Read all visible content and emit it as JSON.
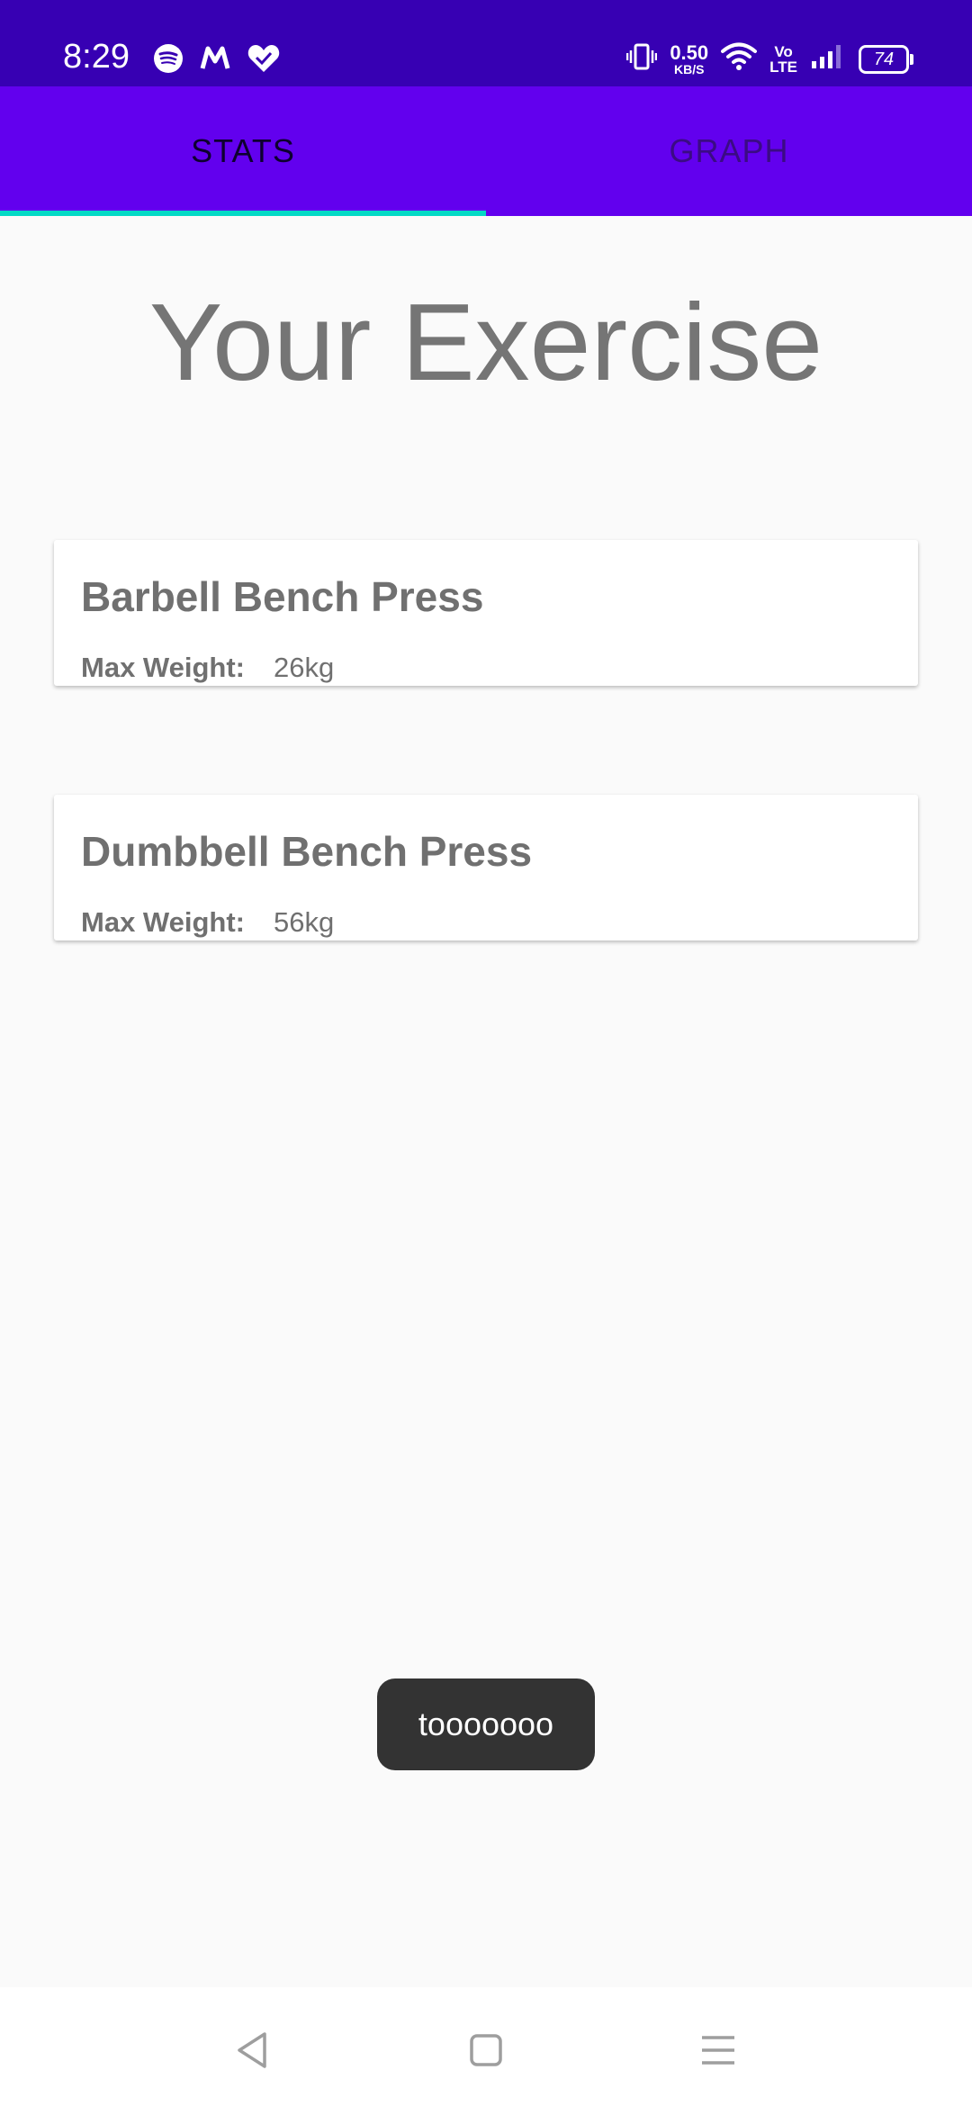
{
  "status_bar": {
    "time": "8:29",
    "speed_value": "0.50",
    "speed_unit": "KB/S",
    "volte_top": "Vo",
    "volte_bottom": "LTE",
    "battery": "74",
    "left_icons": [
      "spotify-icon",
      "m-app-icon",
      "heart-check-icon"
    ],
    "right_icons": [
      "vibrate-icon",
      "wifi-icon",
      "signal-icon"
    ]
  },
  "tabs": [
    {
      "label": "STATS",
      "active": true
    },
    {
      "label": "GRAPH",
      "active": false
    }
  ],
  "main": {
    "title": "Your Exercise",
    "exercises": [
      {
        "name": "Barbell Bench Press",
        "label": "Max Weight:",
        "value": "26kg"
      },
      {
        "name": "Dumbbell Bench Press",
        "label": "Max Weight:",
        "value": "56kg"
      }
    ]
  },
  "toast": {
    "text": "tooooooo"
  },
  "nav": {
    "icons": [
      "back-icon",
      "home-icon",
      "menu-icon"
    ]
  },
  "colors": {
    "status_bar": "#3700b3",
    "tab_bar": "#6200ee",
    "tab_indicator": "#03dac5",
    "background": "#fafafa"
  }
}
